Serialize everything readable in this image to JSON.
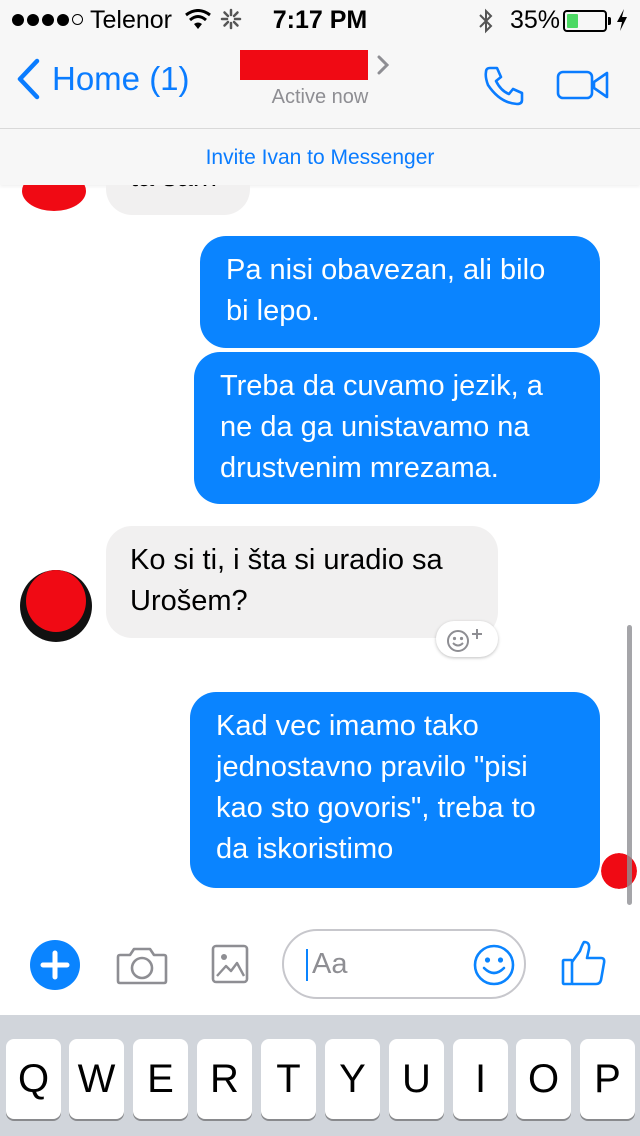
{
  "status_bar": {
    "carrier": "Telenor",
    "time": "7:17 PM",
    "battery_percent": "35%",
    "battery_level": 0.35,
    "battery_color": "#4cd964"
  },
  "nav": {
    "back_label": "Home (1)",
    "status": "Active now",
    "icons": [
      "back-chevron-icon",
      "chevron-right-icon",
      "phone-icon",
      "video-camera-icon"
    ]
  },
  "invite": {
    "text": "Invite Ivan to Messenger"
  },
  "messages": [
    {
      "direction": "in",
      "text": "ta sam"
    },
    {
      "direction": "out",
      "text": "Pa nisi obavezan, ali bilo\nbi lepo."
    },
    {
      "direction": "out",
      "text": "Treba da cuvamo jezik, a\nne da ga unistavamo na\ndrustvenim mrezama."
    },
    {
      "direction": "in",
      "text": "Ko si ti, i šta si uradio sa\nUrošem?"
    },
    {
      "direction": "out",
      "text": "Kad vec imamo tako\njednostavno pravilo \"pisi\nkao sto govoris\", treba to\nda iskoristimo"
    }
  ],
  "composer": {
    "placeholder": "Aa",
    "icons": [
      "plus-icon",
      "camera-icon",
      "gallery-icon",
      "emoji-icon",
      "thumbs-up-icon"
    ]
  },
  "keyboard": {
    "keys": [
      "Q",
      "W",
      "E",
      "R",
      "T",
      "Y",
      "U",
      "I",
      "O",
      "P"
    ]
  },
  "colors": {
    "accent": "#0a84ff",
    "link": "#0a7cff",
    "incoming_bubble": "#f1f0f0",
    "redaction": "#f00a14"
  }
}
